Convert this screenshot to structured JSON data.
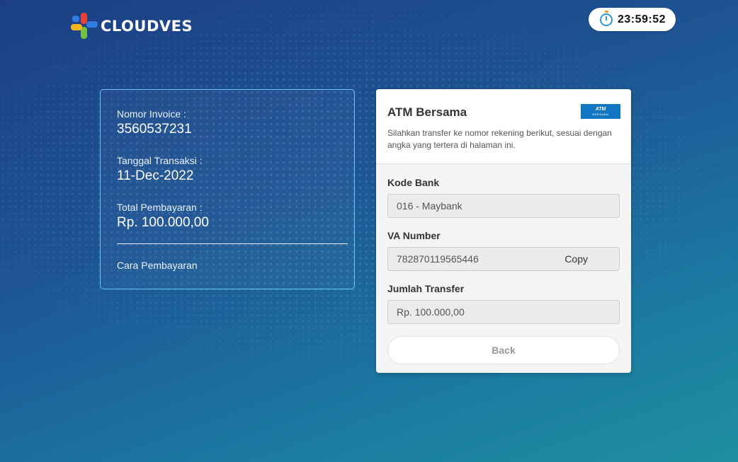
{
  "brand": {
    "name": "CLOUDVES"
  },
  "timer": {
    "value": "23:59:52",
    "icon": "stopwatch-icon"
  },
  "invoice": {
    "invoice_label": "Nomor Invoice :",
    "invoice_number": "3560537231",
    "date_label": "Tanggal Transaksi :",
    "date_value": "11-Dec-2022",
    "total_label": "Total Pembayaran :",
    "total_value": "Rp. 100.000,00",
    "how_to_pay": "Cara Pembayaran"
  },
  "payment": {
    "title": "ATM Bersama",
    "logo_line1": "ATM",
    "logo_line2": "BERSAMA",
    "description": "Silahkan transfer ke nomor rekening berikut, sesuai dengan angka yang tertera di halaman ini.",
    "bank_code_label": "Kode Bank",
    "bank_code_value": "016 - Maybank",
    "va_label": "VA Number",
    "va_value": "782870119565446",
    "copy_label": "Copy",
    "amount_label": "Jumlah Transfer",
    "amount_value": "Rp. 100.000,00",
    "back_label": "Back"
  },
  "colors": {
    "background_start": "#1c3f84",
    "background_end": "#1f8f9f",
    "card_border": "#66c7ef",
    "atm_blue": "#1177c2"
  }
}
